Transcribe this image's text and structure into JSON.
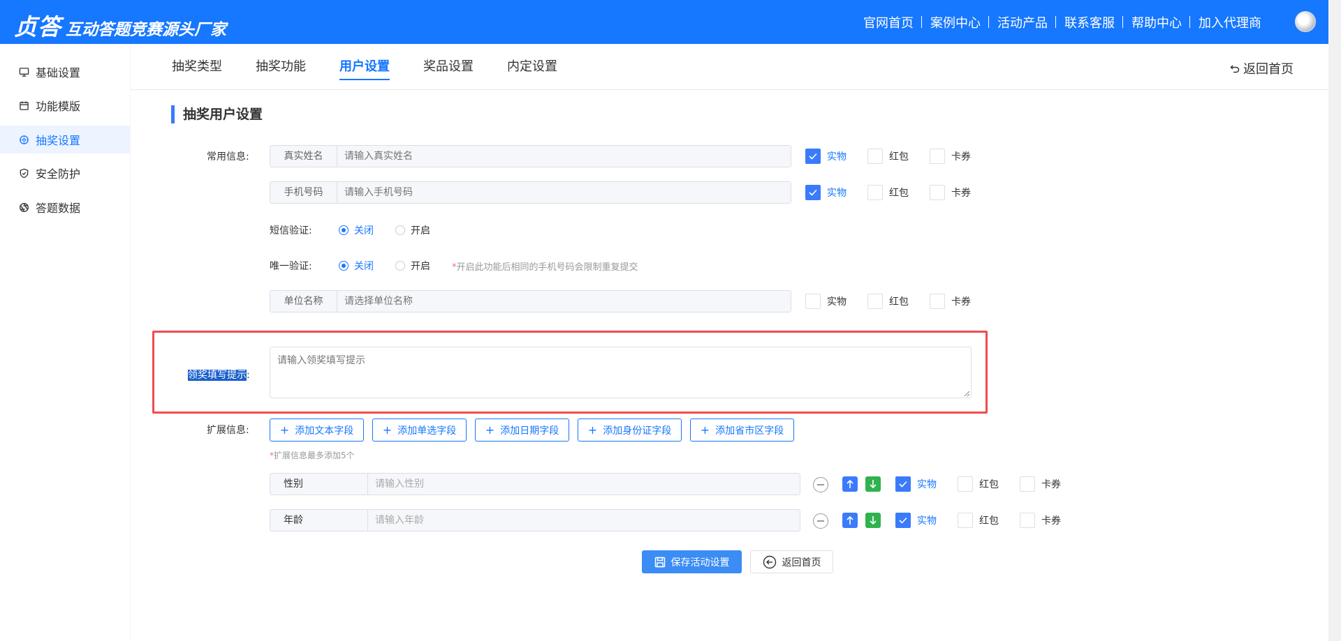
{
  "header": {
    "brand_main": "贞答",
    "brand_slogan": "互动答题竞赛源头厂家",
    "nav": [
      "官网首页",
      "案例中心",
      "活动产品",
      "联系客服",
      "帮助中心",
      "加入代理商"
    ]
  },
  "sidebar": {
    "items": [
      {
        "label": "基础设置",
        "icon": "monitor-icon"
      },
      {
        "label": "功能模版",
        "icon": "calendar-icon"
      },
      {
        "label": "抽奖设置",
        "icon": "settings-icon",
        "active": true
      },
      {
        "label": "安全防护",
        "icon": "shield-icon"
      },
      {
        "label": "答题数据",
        "icon": "aperture-icon"
      }
    ]
  },
  "tabs": {
    "items": [
      "抽奖类型",
      "抽奖功能",
      "用户设置",
      "奖品设置",
      "内定设置"
    ],
    "active": "用户设置",
    "back_home": "返回首页"
  },
  "form": {
    "section_title": "抽奖用户设置",
    "common_label": "常用信息:",
    "real_name": {
      "prepend": "真实姓名",
      "placeholder": "请输入真实姓名"
    },
    "phone": {
      "prepend": "手机号码",
      "placeholder": "请输入手机号码"
    },
    "company": {
      "prepend": "单位名称",
      "placeholder": "请选择单位名称"
    },
    "check_labels": {
      "physical": "实物",
      "red_packet": "红包",
      "coupon": "卡券"
    },
    "sms_label": "短信验证:",
    "unique_label": "唯一验证:",
    "radio_off": "关闭",
    "radio_on": "开启",
    "unique_note_star": "*",
    "unique_note": "开启此功能后相同的手机号码会限制重复提交",
    "prize_tip_label_selected": "领奖填写提示",
    "prize_tip_colon": ":",
    "prize_tip_placeholder": "请输入领奖填写提示",
    "ext_label": "扩展信息:",
    "add_buttons": [
      "添加文本字段",
      "添加单选字段",
      "添加日期字段",
      "添加身份证字段",
      "添加省市区字段"
    ],
    "ext_note_star": "*",
    "ext_note": "扩展信息最多添加5个",
    "ext_fields": [
      {
        "name": "性别",
        "placeholder": "请输入性别"
      },
      {
        "name": "年龄",
        "placeholder": "请输入年龄"
      }
    ],
    "save_label": "保存活动设置",
    "back_label": "返回首页"
  },
  "colors": {
    "primary": "#1677ff",
    "header": "#1677ff",
    "highlight": "#ee4d4d",
    "down_arrow": "#2fb24f"
  }
}
